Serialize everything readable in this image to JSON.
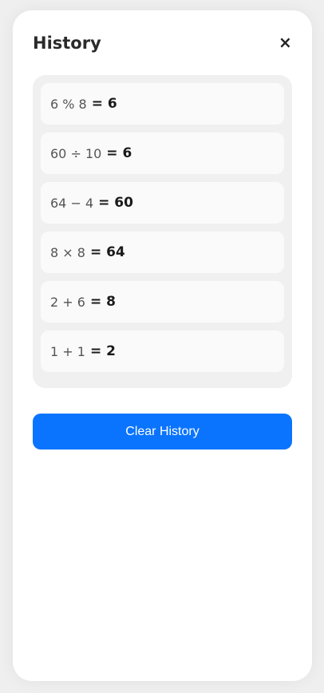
{
  "header": {
    "title": "History",
    "close_icon": "×"
  },
  "history": [
    {
      "expression": "6 % 8",
      "result": "= 6"
    },
    {
      "expression": "60 ÷ 10",
      "result": "= 6"
    },
    {
      "expression": "64 − 4",
      "result": "= 60"
    },
    {
      "expression": "8 × 8",
      "result": "= 64"
    },
    {
      "expression": "2 + 6",
      "result": "= 8"
    },
    {
      "expression": "1 + 1",
      "result": "= 2"
    }
  ],
  "actions": {
    "clear_label": "Clear History"
  },
  "colors": {
    "accent": "#0a74ff"
  }
}
